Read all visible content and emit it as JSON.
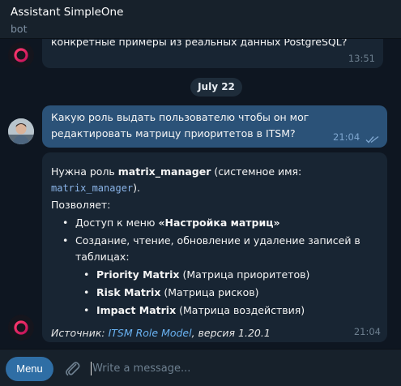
{
  "header": {
    "title": "Assistant SimpleOne",
    "subtitle": "bot"
  },
  "messages": [
    {
      "type": "incoming",
      "text": "конкретные примеры из реальных данных PostgreSQL?",
      "time": "13:51"
    },
    {
      "type": "date",
      "label": "July 22"
    },
    {
      "type": "outgoing",
      "text": "Какую роль выдать пользователю чтобы он мог редактировать матрицу приоритетов в ITSM?",
      "time": "21:04",
      "status_icon": "double-check-icon"
    },
    {
      "type": "incoming",
      "intro_pre": "Нужна роль ",
      "role_bold": "matrix_manager",
      "intro_mid": " (системное имя: ",
      "role_code": "matrix_manager",
      "intro_end": ").",
      "allows": "Позволяет:",
      "bullet1_pre": "Доступ к меню ",
      "bullet1_bold": "«Настройка матриц»",
      "bullet2": "Создание, чтение, обновление и удаление записей в таблицах:",
      "tables": [
        {
          "name": "Priority Matrix",
          "desc": " (Матрица приоритетов)"
        },
        {
          "name": "Risk Matrix",
          "desc": " (Матрица рисков)"
        },
        {
          "name": "Impact Matrix",
          "desc": " (Матрица воздействия)"
        }
      ],
      "source_pre": "Источник: ",
      "source_link": "ITSM Role Model",
      "source_post": ", версия 1.20.1",
      "time": "21:04"
    }
  ],
  "composer": {
    "menu_label": "Menu",
    "placeholder": "Write a message..."
  },
  "colors": {
    "background": "#0e1621",
    "header": "#17212b",
    "bubble_in": "#182533",
    "bubble_out": "#2b5278",
    "accent": "#2f6ea5",
    "link": "#6ab3f3"
  }
}
